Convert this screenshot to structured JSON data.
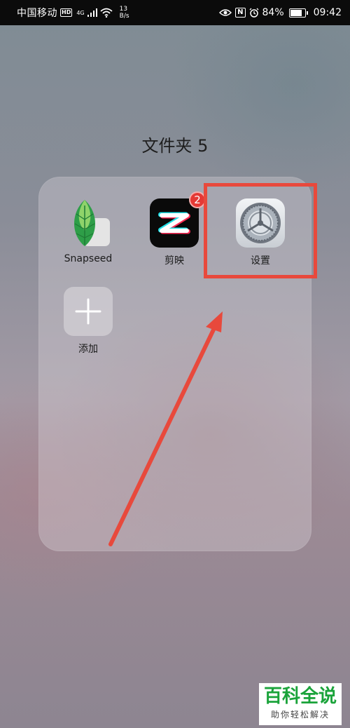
{
  "status_bar": {
    "carrier": "中国移动",
    "hd": "HD",
    "network": "4G",
    "speed_value": "13",
    "speed_unit": "B/s",
    "nfc": "N",
    "battery_percent": "84%",
    "battery_level": 0.84,
    "time": "09:42"
  },
  "folder": {
    "title": "文件夹 5",
    "apps": [
      {
        "label": "Snapseed"
      },
      {
        "label": "剪映",
        "badge": "2"
      },
      {
        "label": "设置"
      },
      {
        "label": "添加"
      }
    ]
  },
  "watermark": {
    "title": "百科全说",
    "subtitle": "助你轻松解决"
  },
  "colors": {
    "annotation_red": "#e8493c",
    "badge_red": "#e53935",
    "watermark_green": "#1aa33a"
  }
}
